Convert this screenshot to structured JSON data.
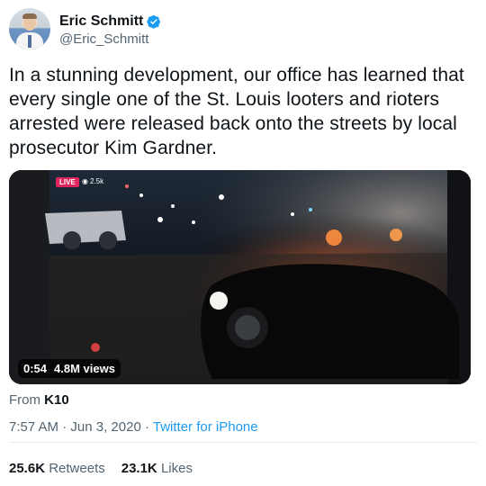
{
  "author": {
    "name": "Eric Schmitt",
    "handle": "@Eric_Schmitt"
  },
  "tweet": {
    "text": "In a stunning development, our office has learned that every single one of the St. Louis looters and rioters arrested were released back onto the streets by local prosecutor Kim Gardner."
  },
  "media": {
    "live_label": "LIVE",
    "live_viewers": "2.5k",
    "duration": "0:54",
    "views": "4.8M views"
  },
  "attribution": {
    "from_label": "From",
    "from_source": "K10"
  },
  "meta": {
    "time": "7:57 AM",
    "date": "Jun 3, 2020",
    "source": "Twitter for iPhone",
    "separator": "·"
  },
  "stats": {
    "retweets_count": "25.6K",
    "retweets_label": "Retweets",
    "likes_count": "23.1K",
    "likes_label": "Likes"
  },
  "colors": {
    "accent": "#1d9bf0",
    "live_red": "#e0245e"
  }
}
